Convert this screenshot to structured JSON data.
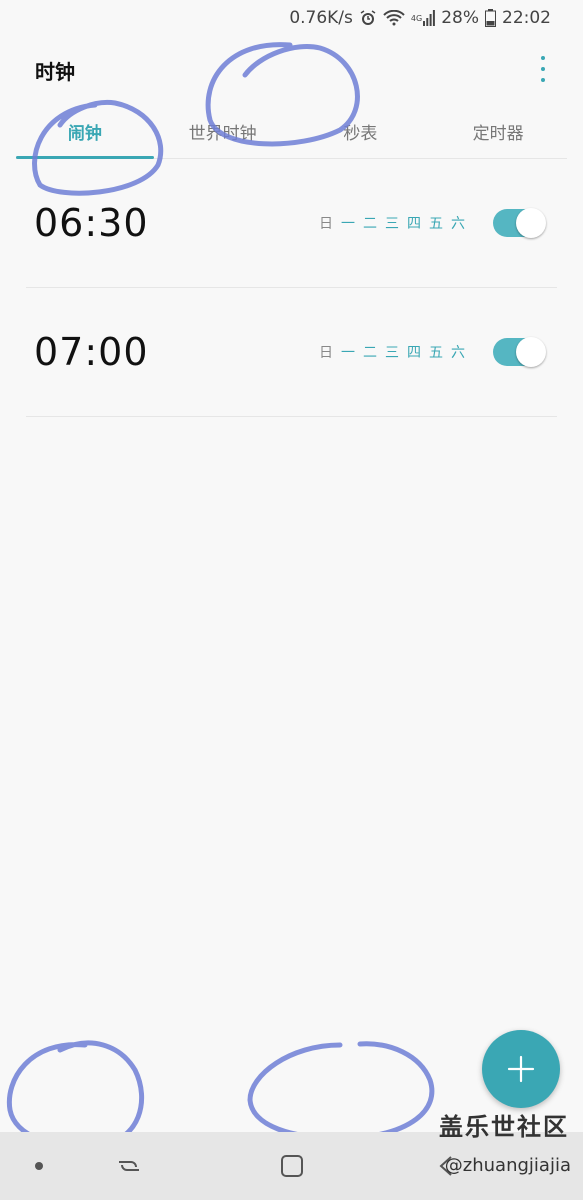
{
  "status_bar": {
    "speed": "0.76K/s",
    "network": "4G",
    "battery": "28%",
    "time": "22:02"
  },
  "app": {
    "title": "时钟"
  },
  "tabs": [
    {
      "label": "闹钟",
      "active": true
    },
    {
      "label": "世界时钟",
      "active": false
    },
    {
      "label": "秒表",
      "active": false
    },
    {
      "label": "定时器",
      "active": false
    }
  ],
  "alarms": [
    {
      "time": "06:30",
      "days": [
        "日",
        "一",
        "二",
        "三",
        "四",
        "五",
        "六"
      ],
      "enabled": true
    },
    {
      "time": "07:00",
      "days": [
        "日",
        "一",
        "二",
        "三",
        "四",
        "五",
        "六"
      ],
      "enabled": true
    }
  ],
  "watermark": {
    "line1": "盖乐世社区",
    "line2": "@zhuangjiajia"
  },
  "colors": {
    "accent": "#3aa7b4",
    "toggle_on": "#55b6c2",
    "scribble": "#6f7fd6"
  },
  "icons": [
    "alarm-status-icon",
    "wifi-icon",
    "signal-icon",
    "battery-icon",
    "more-vertical-icon",
    "add-icon",
    "recents-icon",
    "home-icon",
    "back-icon"
  ]
}
